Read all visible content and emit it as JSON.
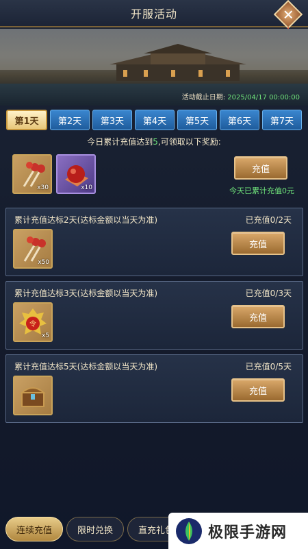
{
  "header": {
    "title": "开服活动"
  },
  "banner": {
    "deadline_label": "活动截止日期:",
    "deadline_date": "2025/04/17 00:00:00"
  },
  "tabs": [
    {
      "label": "第1天",
      "active": true
    },
    {
      "label": "第2天"
    },
    {
      "label": "第3天"
    },
    {
      "label": "第4天"
    },
    {
      "label": "第5天"
    },
    {
      "label": "第6天"
    },
    {
      "label": "第7天"
    }
  ],
  "today": {
    "hint_prefix": "今日累计充值达到",
    "hint_num": "5",
    "hint_suffix": ",可领取以下奖励:",
    "items": [
      {
        "icon": "firecracker-icon",
        "qty": "x30"
      },
      {
        "icon": "red-orb-icon",
        "qty": "x10"
      }
    ],
    "button": "充值",
    "status": "今天已累计充值0元"
  },
  "cards": [
    {
      "title": "累计充值达标2天(达标金额以当天为准)",
      "progress": "已充值0/2天",
      "item": {
        "icon": "firecracker-icon",
        "qty": "x50"
      },
      "button": "充值"
    },
    {
      "title": "累计充值达标3天(达标金额以当天为准)",
      "progress": "已充值0/3天",
      "item": {
        "icon": "golden-token-icon",
        "qty": "x5"
      },
      "button": "充值"
    },
    {
      "title": "累计充值达标5天(达标金额以当天为准)",
      "progress": "已充值0/5天",
      "item": {
        "icon": "treasure-chest-icon",
        "qty": ""
      },
      "button": "充值"
    }
  ],
  "bottom_tabs": [
    {
      "label": "连续充值",
      "active": true
    },
    {
      "label": "限时兑换"
    },
    {
      "label": "直充礼包"
    }
  ],
  "watermark": {
    "text": "极限手游网"
  }
}
